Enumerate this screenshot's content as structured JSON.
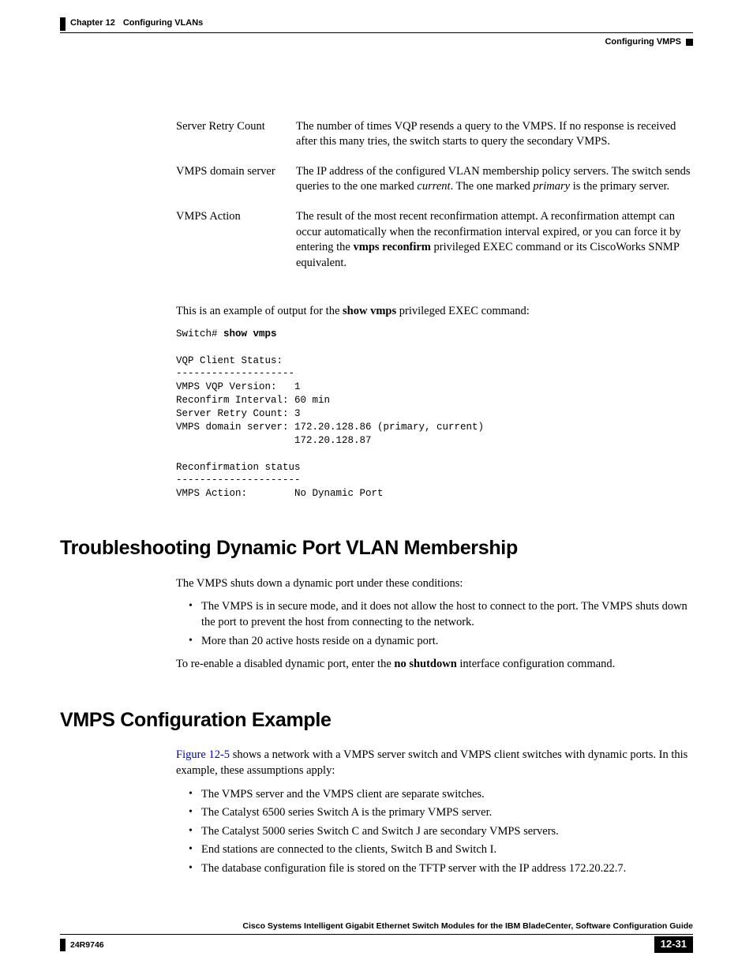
{
  "header": {
    "chapter_label": "Chapter 12",
    "chapter_title": "Configuring VLANs",
    "section_title": "Configuring VMPS"
  },
  "definitions": [
    {
      "term": "Server Retry Count",
      "desc_html": "The number of times VQP resends a query to the VMPS. If no response is received after this many tries, the switch starts to query the secondary VMPS."
    },
    {
      "term": "VMPS domain server",
      "desc_html": "The IP address of the configured VLAN membership policy servers. The switch sends queries to the one marked <i>current</i>. The one marked <i>primary</i> is the primary server."
    },
    {
      "term": "VMPS Action",
      "desc_html": "The result of the most recent reconfirmation attempt. A reconfirmation attempt can occur automatically when the reconfirmation interval expired, or you can force it by entering the <b>vmps reconfirm</b> privileged EXEC command or its CiscoWorks SNMP equivalent."
    }
  ],
  "example_intro_html": "This is an example of output for the <b>show vmps</b> privileged EXEC command:",
  "cli_prompt": "Switch# ",
  "cli_command": "show vmps",
  "cli_output": "VQP Client Status:\n--------------------\nVMPS VQP Version:   1\nReconfirm Interval: 60 min\nServer Retry Count: 3\nVMPS domain server: 172.20.128.86 (primary, current)\n                    172.20.128.87\n\nReconfirmation status\n---------------------\nVMPS Action:        No Dynamic Port",
  "sec1": {
    "heading": "Troubleshooting Dynamic Port VLAN Membership",
    "intro": "The VMPS shuts down a dynamic port under these conditions:",
    "bullets": [
      "The VMPS is in secure mode, and it does not allow the host to connect to the port. The VMPS shuts down the port to prevent the host from connecting to the network.",
      "More than 20 active hosts reside on a dynamic port."
    ],
    "outro_html": "To re-enable a disabled dynamic port, enter the <b>no shutdown</b> interface configuration command."
  },
  "sec2": {
    "heading": "VMPS Configuration Example",
    "figure_ref": "Figure 12-5",
    "intro_rest": " shows a network with a VMPS server switch and VMPS client switches with dynamic ports. In this example, these assumptions apply:",
    "bullets": [
      "The VMPS server and the VMPS client are separate switches.",
      "The Catalyst 6500 series Switch A is the primary VMPS server.",
      "The Catalyst 5000 series Switch C and Switch J are secondary VMPS servers.",
      "End stations are connected to the clients, Switch B and Switch I.",
      "The database configuration file is stored on the TFTP server with the IP address 172.20.22.7."
    ]
  },
  "footer": {
    "book_title": "Cisco Systems Intelligent Gigabit Ethernet Switch Modules for the IBM BladeCenter, Software Configuration Guide",
    "doc_id": "24R9746",
    "page_number": "12-31"
  }
}
